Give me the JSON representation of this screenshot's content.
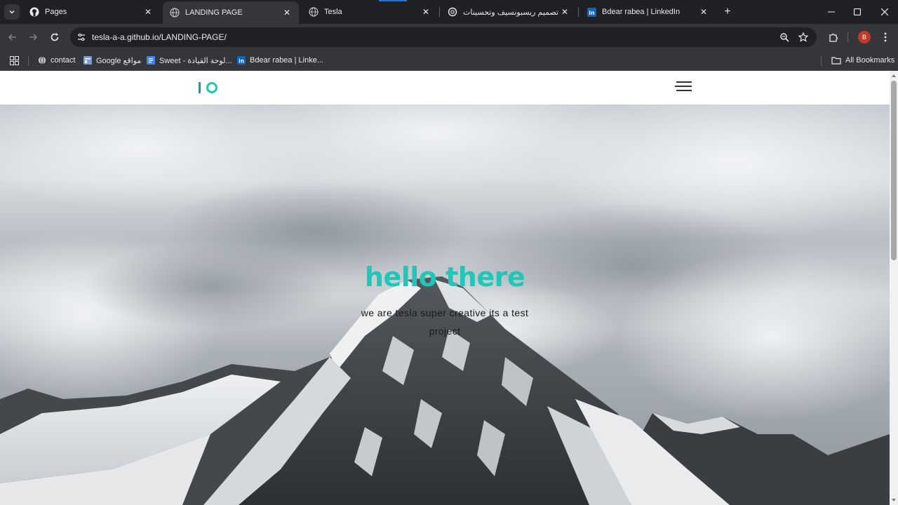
{
  "browser": {
    "tabs": [
      {
        "title": "Pages",
        "icon": "github-icon",
        "active": false
      },
      {
        "title": "LANDING PAGE",
        "icon": "globe-icon",
        "active": true
      },
      {
        "title": "Tesla",
        "icon": "globe-icon",
        "active": false
      },
      {
        "title": "تصميم ريسبونسيف وتحسينات",
        "icon": "openai-icon",
        "active": false
      },
      {
        "title": "Bdear rabea | LinkedIn",
        "icon": "linkedin-icon",
        "active": false
      }
    ],
    "url": "tesla-a-a.github.io/LANDING-PAGE/",
    "profile_initial": "B",
    "bookmarks": [
      {
        "label": "contact",
        "icon": "globe-icon"
      },
      {
        "label": "Google مواقع",
        "icon": "google-sites-icon"
      },
      {
        "label": "Sweet - لوحة القيادة...",
        "icon": "docs-icon"
      },
      {
        "label": "Bdear rabea | Linke...",
        "icon": "linkedin-icon"
      }
    ],
    "all_bookmarks_label": "All Bookmarks"
  },
  "page": {
    "hero": {
      "title": "hello there",
      "subtitle": "we are tesla super creative its a test project"
    },
    "colors": {
      "accent": "#1fc7b8",
      "logo_bar": "#1a9aa0",
      "header_bg": "#ffffff"
    }
  }
}
